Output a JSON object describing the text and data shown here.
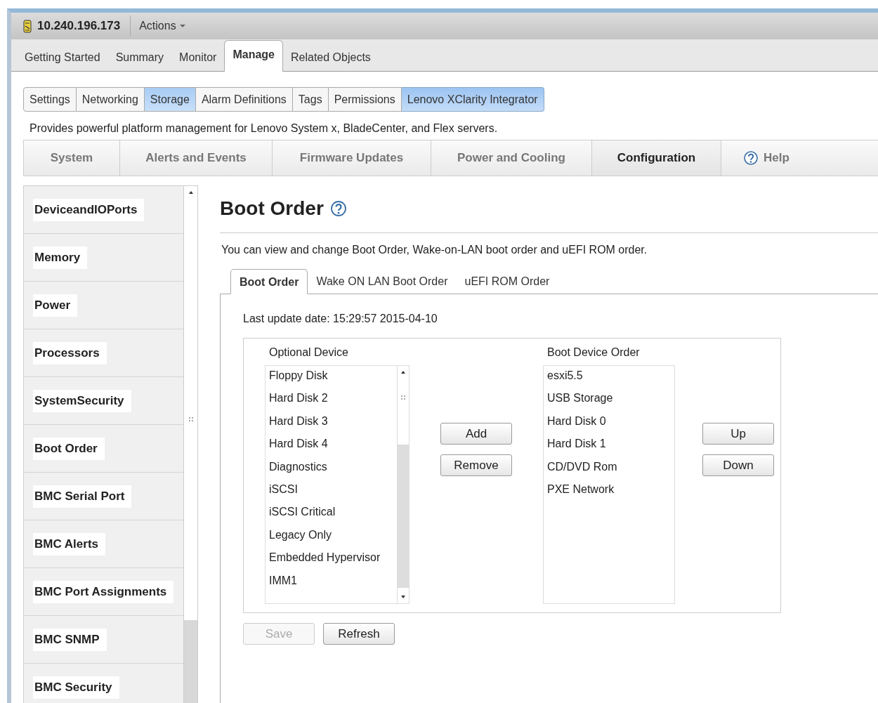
{
  "header": {
    "host": "10.240.196.173",
    "actions": "Actions"
  },
  "tabs": [
    {
      "label": "Getting Started",
      "selected": false
    },
    {
      "label": "Summary",
      "selected": false
    },
    {
      "label": "Monitor",
      "selected": false
    },
    {
      "label": "Manage",
      "selected": true
    },
    {
      "label": "Related Objects",
      "selected": false
    }
  ],
  "subtabs": [
    {
      "label": "Settings",
      "selected": false,
      "hovered": false
    },
    {
      "label": "Networking",
      "selected": false,
      "hovered": false
    },
    {
      "label": "Storage",
      "selected": false,
      "hovered": true
    },
    {
      "label": "Alarm Definitions",
      "selected": false,
      "hovered": false
    },
    {
      "label": "Tags",
      "selected": false,
      "hovered": false
    },
    {
      "label": "Permissions",
      "selected": false,
      "hovered": false
    },
    {
      "label": "Lenovo XClarity Integrator",
      "selected": true,
      "hovered": false
    }
  ],
  "description": "Provides powerful platform management for Lenovo System x, BladeCenter, and Flex servers.",
  "nav": [
    {
      "label": "System",
      "selected": false,
      "kind": "text"
    },
    {
      "label": "Alerts and Events",
      "selected": false,
      "kind": "text"
    },
    {
      "label": "Firmware Updates",
      "selected": false,
      "kind": "text"
    },
    {
      "label": "Power and Cooling",
      "selected": false,
      "kind": "text"
    },
    {
      "label": "Configuration",
      "selected": true,
      "kind": "text"
    },
    {
      "label": "Help",
      "selected": false,
      "kind": "help"
    }
  ],
  "sidebar": {
    "items": [
      {
        "label": "DeviceandIOPorts"
      },
      {
        "label": "Memory"
      },
      {
        "label": "Power"
      },
      {
        "label": "Processors"
      },
      {
        "label": "SystemSecurity"
      },
      {
        "label": "Boot Order"
      },
      {
        "label": "BMC Serial Port"
      },
      {
        "label": "BMC Alerts"
      },
      {
        "label": "BMC Port Assignments"
      },
      {
        "label": "BMC SNMP"
      },
      {
        "label": "BMC Security"
      }
    ]
  },
  "content": {
    "title": "Boot Order",
    "intro": "You can view and change Boot Order, Wake-on-LAN boot order and uEFI ROM order.",
    "tabs": [
      {
        "label": "Boot Order",
        "selected": true
      },
      {
        "label": "Wake ON LAN Boot Order",
        "selected": false
      },
      {
        "label": "uEFI ROM Order",
        "selected": false
      }
    ],
    "last_update": "Last update date: 15:29:57 2015-04-10",
    "optional": {
      "heading": "Optional Device",
      "items": [
        "Floppy Disk",
        "Hard Disk 2",
        "Hard Disk 3",
        "Hard Disk 4",
        "Diagnostics",
        "iSCSI",
        "iSCSI Critical",
        "Legacy Only",
        "Embedded Hypervisor",
        "IMM1"
      ]
    },
    "move_buttons": [
      {
        "label": "Add",
        "disabled": false
      },
      {
        "label": "Remove",
        "disabled": false
      }
    ],
    "order": {
      "heading": "Boot Device Order",
      "items": [
        "esxi5.5",
        "USB Storage",
        "Hard Disk 0",
        "Hard Disk 1",
        "CD/DVD Rom",
        "PXE Network"
      ]
    },
    "order_buttons": [
      {
        "label": "Up",
        "disabled": false
      },
      {
        "label": "Down",
        "disabled": false
      }
    ],
    "actions": [
      {
        "label": "Save",
        "disabled": true
      },
      {
        "label": "Refresh",
        "disabled": false
      }
    ]
  }
}
